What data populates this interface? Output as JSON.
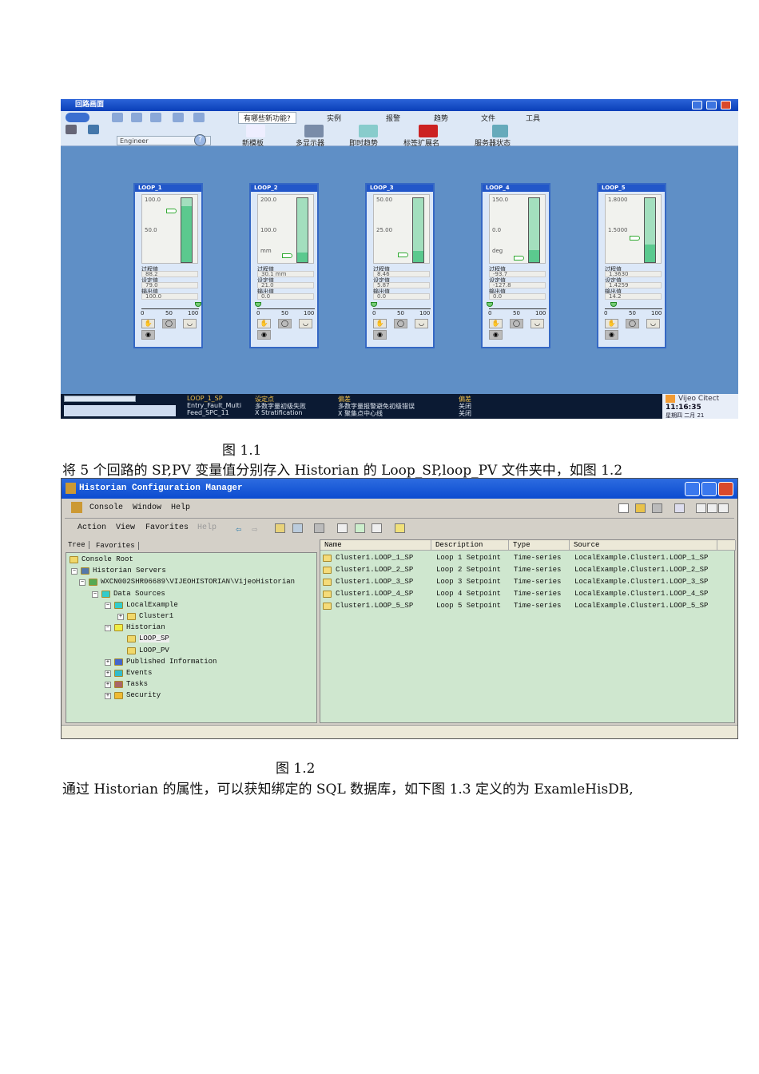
{
  "screen1": {
    "title": "回路画面",
    "toolbar": {
      "tabs": [
        "有哪些新功能?",
        "实例",
        "报警",
        "趋势",
        "文件",
        "工具"
      ],
      "user": "Engineer",
      "buttons": [
        "新模板",
        "多显示器",
        "即时趋势",
        "标签扩展名",
        "服务器状态"
      ]
    },
    "labels": {
      "pv": "过程值",
      "sp": "设定值",
      "out": "输出值",
      "scale": [
        "0",
        "50",
        "100"
      ]
    },
    "loops": [
      {
        "name": "LOOP_1",
        "top": "100.0",
        "mid": "50.0",
        "unit": "",
        "pv": "88.2",
        "sp": "79.0",
        "out": "100.0",
        "pv_frac": 0.88,
        "sp_frac": 0.79,
        "out_frac": 1.0
      },
      {
        "name": "LOOP_2",
        "top": "200.0",
        "mid": "100.0",
        "unit": "mm",
        "pv": "30.1 mm",
        "sp": "21.0",
        "out": "0.0",
        "pv_frac": 0.15,
        "sp_frac": 0.105,
        "out_frac": 0.0
      },
      {
        "name": "LOOP_3",
        "top": "50.00",
        "mid": "25.00",
        "unit": "",
        "pv": "8.46",
        "sp": "5.87",
        "out": "0.0",
        "pv_frac": 0.17,
        "sp_frac": 0.12,
        "out_frac": 0.0
      },
      {
        "name": "LOOP_4",
        "top": "150.0",
        "mid": "0.0",
        "unit": "deg",
        "pv": "-93.7",
        "sp": "-127.8",
        "out": "0.0",
        "pv_frac": 0.19,
        "sp_frac": 0.07,
        "out_frac": 0.0
      },
      {
        "name": "LOOP_5",
        "top": "1.8000",
        "mid": "1.5000",
        "unit": "",
        "pv": "1.3630",
        "sp": "1.4259",
        "out": "14.2",
        "pv_frac": 0.27,
        "sp_frac": 0.38,
        "out_frac": 0.142
      }
    ],
    "alarms": [
      [
        "LOOP_1_SP",
        "设定点",
        "偏差",
        "偏差"
      ],
      [
        "Entry_Fault_Multi",
        "多数字量初级失败",
        "多数字量报警避免初级错误",
        "关闭"
      ],
      [
        "Feed_SPC_11",
        "X Stratification",
        "X 聚集点中心线",
        "关闭"
      ]
    ],
    "brand": "Vijeo Citect",
    "time": "11:16:35",
    "date": "星期四 二月 21"
  },
  "caption1": "图 1.1",
  "para1": "将 5 个回路的 SP,PV 变量值分别存入 Historian 的 Loop_SP,loop_PV 文件夹中，如图 1.2",
  "screen2": {
    "title": "Historian Configuration Manager",
    "menu": [
      "Console",
      "Window",
      "Help"
    ],
    "menu2": [
      "Action",
      "View",
      "Favorites",
      "Help"
    ],
    "tabs": [
      "Tree",
      "Favorites"
    ],
    "tree": [
      "Console Root",
      "Historian Servers",
      "WXCN002SHR06689\\VIJEOHISTORIAN\\VijeoHistorian",
      "Data Sources",
      "LocalExample",
      "Cluster1",
      "Historian",
      "LOOP_SP",
      "LOOP_PV",
      "Published Information",
      "Events",
      "Tasks",
      "Security"
    ],
    "columns": [
      "Name",
      "Description",
      "Type",
      "Source"
    ],
    "rows": [
      [
        "Cluster1.LOOP_1_SP",
        "Loop 1 Setpoint",
        "Time-series",
        "LocalExample.Cluster1.LOOP_1_SP"
      ],
      [
        "Cluster1.LOOP_2_SP",
        "Loop 2 Setpoint",
        "Time-series",
        "LocalExample.Cluster1.LOOP_2_SP"
      ],
      [
        "Cluster1.LOOP_3_SP",
        "Loop 3 Setpoint",
        "Time-series",
        "LocalExample.Cluster1.LOOP_3_SP"
      ],
      [
        "Cluster1.LOOP_4_SP",
        "Loop 4 Setpoint",
        "Time-series",
        "LocalExample.Cluster1.LOOP_4_SP"
      ],
      [
        "Cluster1.LOOP_5_SP",
        "Loop 5 Setpoint",
        "Time-series",
        "LocalExample.Cluster1.LOOP_5_SP"
      ]
    ]
  },
  "caption2": "图 1.2",
  "para2": "通过 Historian 的属性，可以获知绑定的 SQL 数据库，如下图 1.3 定义的为 ExamleHisDB,"
}
